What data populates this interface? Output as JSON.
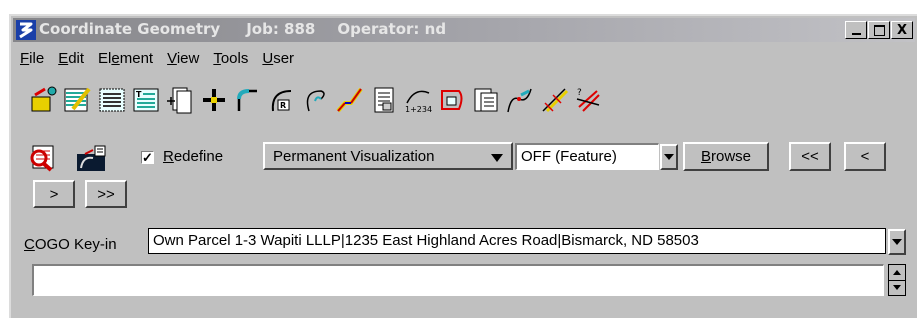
{
  "window": {
    "title": "Coordinate Geometry",
    "job": "Job: 888",
    "operator": "Operator: nd",
    "controls": {
      "minimize_icon": "minimize-icon",
      "maximize_icon": "maximize-icon",
      "close_label": "X"
    }
  },
  "menu": [
    {
      "pre": "",
      "u": "F",
      "post": "ile"
    },
    {
      "pre": "",
      "u": "E",
      "post": "dit"
    },
    {
      "pre": "El",
      "u": "e",
      "post": "ment"
    },
    {
      "pre": "",
      "u": "V",
      "post": "iew"
    },
    {
      "pre": "",
      "u": "T",
      "post": "ools"
    },
    {
      "pre": "",
      "u": "U",
      "post": "ser"
    }
  ],
  "toolbar_icons": [
    "open-job-icon",
    "edit-job-icon",
    "store-list-icon",
    "text-list-icon",
    "copy-element-icon",
    "locate-point-icon",
    "curve-arc-icon",
    "radius-curve-icon",
    "spiral-curve-icon",
    "chain-icon",
    "document-icon",
    "station-1234-icon",
    "parcel-icon",
    "report-icon",
    "route-curve-icon",
    "offset-line-icon",
    "intersect-icon"
  ],
  "row2": {
    "zoom_icon": "zoom-visualization-icon",
    "redefine_icon": "redefine-icon",
    "redefine_checked": "✓",
    "redefine_label_underline": "R",
    "redefine_label_rest": "edefine",
    "visualization_value": "Permanent Visualization",
    "feature_value": "OFF (Feature)",
    "browse_u": "B",
    "browse_rest": "rowse",
    "first_label": "<<",
    "prev_label": "<"
  },
  "row3": {
    "next_label": ">",
    "last_label": ">>"
  },
  "keyin": {
    "label_underline": "C",
    "label_rest": "OGO Key-in",
    "value": "Own Parcel 1-3 Wapiti LLLP|1235 East Highland Acres Road|Bismarck, ND 58503"
  },
  "message": {
    "value": ""
  }
}
